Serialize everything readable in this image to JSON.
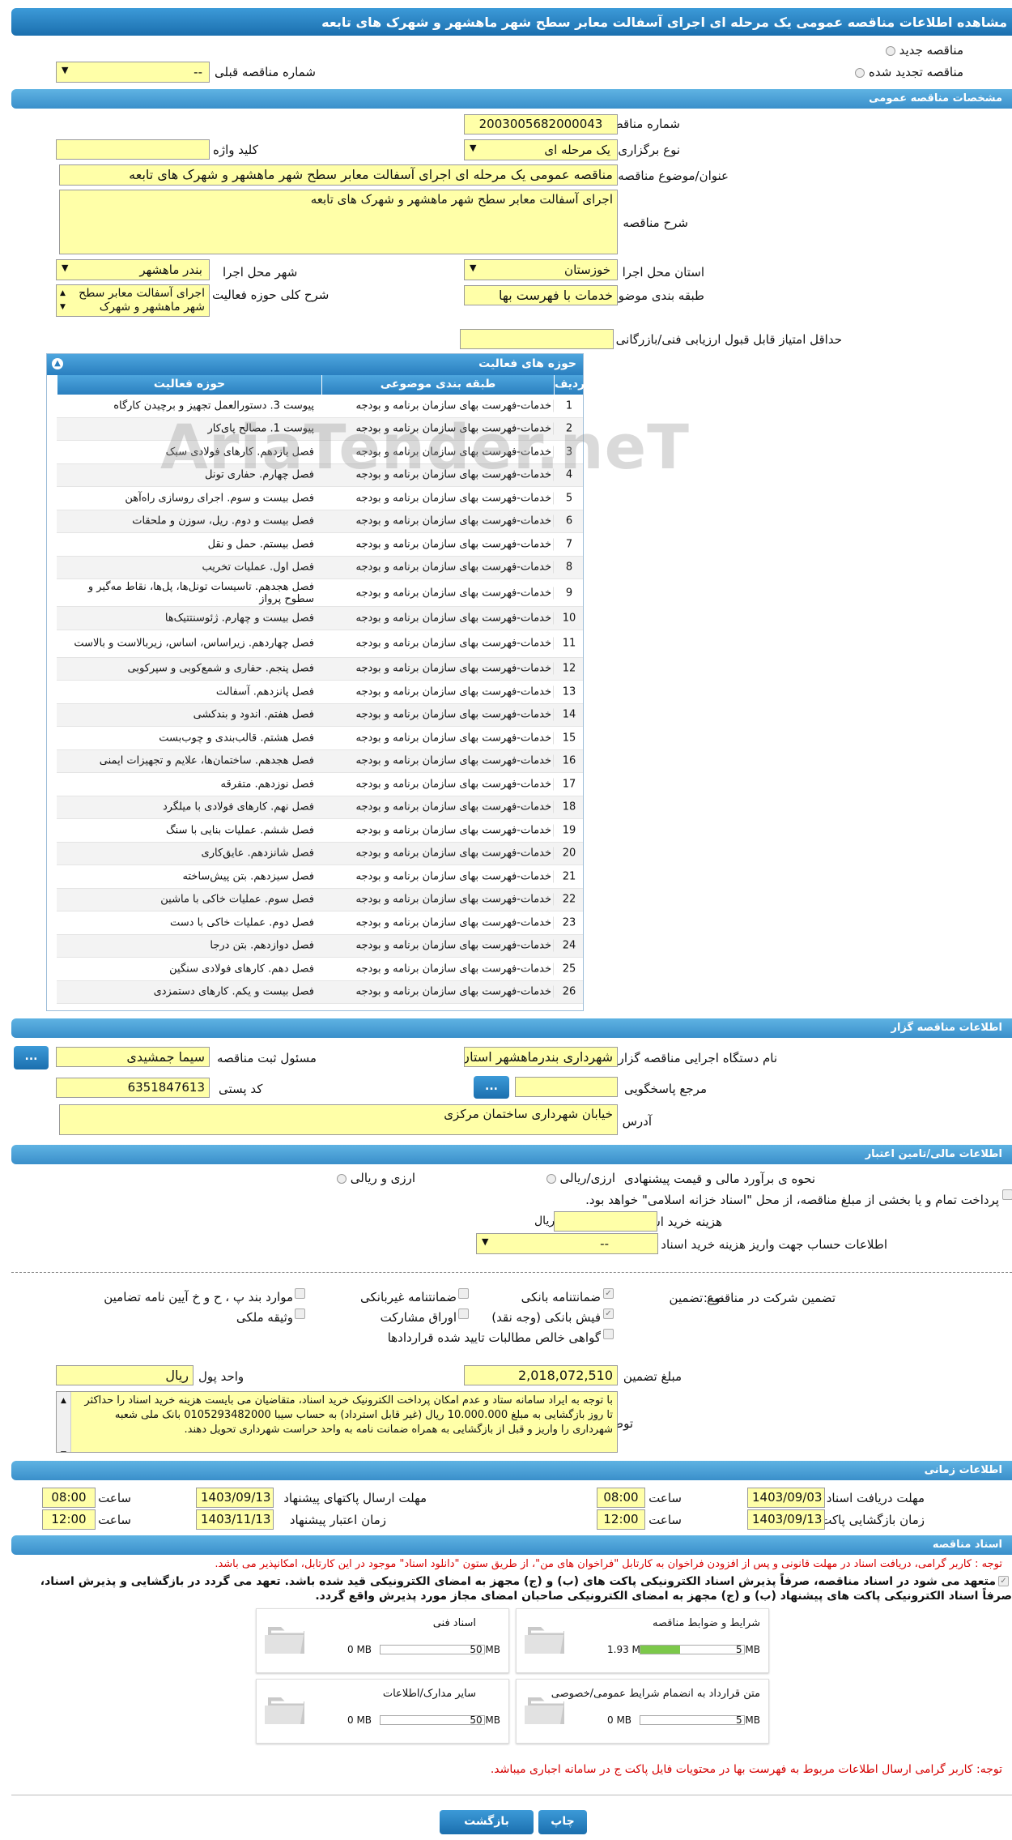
{
  "title": "مشاهده اطلاعات مناقصه عمومی یک مرحله ای اجرای آسفالت معابر سطح شهر ماهشهر و شهرک های تابعه",
  "top": {
    "new_tender": "مناقصه جدید",
    "renewed_tender": "مناقصه تجدید شده",
    "prev_number_label": "شماره مناقصه قبلی",
    "prev_number_value": "--"
  },
  "general": {
    "header": "مشخصات مناقصه عمومی",
    "number_label": "شماره مناقصه",
    "number_value": "2003005682000043",
    "type_label": "نوع برگزاری",
    "type_value": "یک مرحله ای",
    "keyword_label": "کلید واژه",
    "keyword_value": "",
    "subject_label": "عنوان/موضوع مناقصه",
    "subject_value": "مناقصه عمومی یک مرحله ای اجرای آسفالت معابر سطح شهر ماهشهر و شهرک های تابعه",
    "desc_label": "شرح مناقصه",
    "desc_value": "اجرای آسفالت معابر سطح شهر ماهشهر و شهرک های تابعه",
    "province_label": "استان محل اجرا",
    "province_value": "خوزستان",
    "city_label": "شهر محل اجرا",
    "city_value": "بندر ماهشهر",
    "category_label": "طبقه بندی موضوعی",
    "category_value": "خدمات با فهرست بها",
    "scope_label": "شرح کلی حوزه فعالیت",
    "scope_value": "اجرای آسفالت معابر سطح شهر ماهشهر و شهرک",
    "min_score_label": "حداقل امتیاز قابل قبول ارزیابی فنی/بازرگانی",
    "min_score_value": ""
  },
  "activities": {
    "header": "حوزه های فعالیت",
    "col_row": "ردیف",
    "col_category": "طبقه بندی موضوعی",
    "col_scope": "حوزه فعالیت",
    "rows": [
      {
        "n": "1",
        "cat": "خدمات-فهرست بهای سازمان برنامه و بودجه",
        "scope": "پیوست 3. دستورالعمل تجهیز و برچیدن کارگاه"
      },
      {
        "n": "2",
        "cat": "خدمات-فهرست بهای سازمان برنامه و بودجه",
        "scope": "پیوست 1. مصالح پای‌کار"
      },
      {
        "n": "3",
        "cat": "خدمات-فهرست بهای سازمان برنامه و بودجه",
        "scope": "فصل یازدهم. کارهای فولادی سبک"
      },
      {
        "n": "4",
        "cat": "خدمات-فهرست بهای سازمان برنامه و بودجه",
        "scope": "فصل چهارم. حفاری تونل"
      },
      {
        "n": "5",
        "cat": "خدمات-فهرست بهای سازمان برنامه و بودجه",
        "scope": "فصل بیست و سوم. اجرای روسازی راه‌آهن"
      },
      {
        "n": "6",
        "cat": "خدمات-فهرست بهای سازمان برنامه و بودجه",
        "scope": "فصل بیست و دوم. ریل، سوزن و ملحقات"
      },
      {
        "n": "7",
        "cat": "خدمات-فهرست بهای سازمان برنامه و بودجه",
        "scope": "فصل بیستم. حمل و نقل"
      },
      {
        "n": "8",
        "cat": "خدمات-فهرست بهای سازمان برنامه و بودجه",
        "scope": "فصل اول. عملیات تخریب"
      },
      {
        "n": "9",
        "cat": "خدمات-فهرست بهای سازمان برنامه و بودجه",
        "scope": "فصل هجدهم. تاسیسات تونل‌ها، پل‌ها، نقاط مه‌گیر و سطوح پرواز"
      },
      {
        "n": "10",
        "cat": "خدمات-فهرست بهای سازمان برنامه و بودجه",
        "scope": "فصل بیست و چهارم. ژئوسنتتیک‌ها"
      },
      {
        "n": "11",
        "cat": "خدمات-فهرست بهای سازمان برنامه و بودجه",
        "scope": "فصل چهاردهم. زیراساس، اساس، زیربالاست و بالاست"
      },
      {
        "n": "12",
        "cat": "خدمات-فهرست بهای سازمان برنامه و بودجه",
        "scope": "فصل پنجم. حفاری و شمع‌کوبی و سپرکوبی"
      },
      {
        "n": "13",
        "cat": "خدمات-فهرست بهای سازمان برنامه و بودجه",
        "scope": "فصل پانزدهم. آسفالت"
      },
      {
        "n": "14",
        "cat": "خدمات-فهرست بهای سازمان برنامه و بودجه",
        "scope": "فصل هفتم. اندود و بندکشی"
      },
      {
        "n": "15",
        "cat": "خدمات-فهرست بهای سازمان برنامه و بودجه",
        "scope": "فصل هشتم. قالب‌بندی و چوب‌بست"
      },
      {
        "n": "16",
        "cat": "خدمات-فهرست بهای سازمان برنامه و بودجه",
        "scope": "فصل هجدهم. ساختمان‌ها، علایم و تجهیزات ایمنی"
      },
      {
        "n": "17",
        "cat": "خدمات-فهرست بهای سازمان برنامه و بودجه",
        "scope": "فصل نوزدهم. متفرقه"
      },
      {
        "n": "18",
        "cat": "خدمات-فهرست بهای سازمان برنامه و بودجه",
        "scope": "فصل نهم. کارهای فولادی با میلگرد"
      },
      {
        "n": "19",
        "cat": "خدمات-فهرست بهای سازمان برنامه و بودجه",
        "scope": "فصل ششم. عملیات بنایی با سنگ"
      },
      {
        "n": "20",
        "cat": "خدمات-فهرست بهای سازمان برنامه و بودجه",
        "scope": "فصل شانزدهم. عایق‌کاری"
      },
      {
        "n": "21",
        "cat": "خدمات-فهرست بهای سازمان برنامه و بودجه",
        "scope": "فصل سیزدهم. بتن پیش‌ساخته"
      },
      {
        "n": "22",
        "cat": "خدمات-فهرست بهای سازمان برنامه و بودجه",
        "scope": "فصل سوم. عملیات خاکی با ماشین"
      },
      {
        "n": "23",
        "cat": "خدمات-فهرست بهای سازمان برنامه و بودجه",
        "scope": "فصل دوم. عملیات خاکی با دست"
      },
      {
        "n": "24",
        "cat": "خدمات-فهرست بهای سازمان برنامه و بودجه",
        "scope": "فصل دوازدهم. بتن درجا"
      },
      {
        "n": "25",
        "cat": "خدمات-فهرست بهای سازمان برنامه و بودجه",
        "scope": "فصل دهم. کارهای فولادی سنگین"
      },
      {
        "n": "26",
        "cat": "خدمات-فهرست بهای سازمان برنامه و بودجه",
        "scope": "فصل بیست و یکم. کارهای دستمزدی"
      }
    ]
  },
  "organizer": {
    "header": "اطلاعات مناقصه گزار",
    "org_label": "نام دستگاه اجرایی مناقصه گزار",
    "org_value": "شهرداری بندرماهشهر استان",
    "officer_label": "مسئول ثبت مناقصه",
    "officer_value": "سیما جمشیدی",
    "ref_label": "مرجع پاسخگویی",
    "ref_value": "",
    "postal_label": "کد پستی",
    "postal_value": "6351847613",
    "address_label": "آدرس",
    "address_value": "خیابان شهرداری ساختمان مرکزی",
    "dots": "..."
  },
  "financial": {
    "header": "اطلاعات مالی/تامین اعتبار",
    "estimate_label": "نحوه ی برآورد مالی و قیمت پیشنهادی",
    "opt_currency_rial": "ارزی/ریالی",
    "opt_currency_and_rial": "ارزی و ریالی",
    "treasury_text": "پرداخت تمام و یا بخشی از مبلغ مناقصه، از محل \"اسناد خزانه اسلامی\" خواهد بود.",
    "doc_cost_label": "هزینه خرید اسناد",
    "doc_cost_value": "",
    "doc_cost_unit": "ریال",
    "account_label": "اطلاعات حساب جهت واریز هزینه خرید اسناد",
    "account_value": "--",
    "guarantee_label": "تضمین شرکت در مناقصه:",
    "guarantee_type_label": "نوع تضمین",
    "g_bank": "ضمانتنامه بانکی",
    "g_nonbank": "ضمانتنامه غیربانکی",
    "g_clauses": "موارد بند پ ، ح و خ آیین نامه تضامین",
    "g_check": "فیش بانکی (وجه نقد)",
    "g_bonds": "اوراق مشارکت",
    "g_property": "وثیقه ملکی",
    "g_claims": "گواهی خالص مطالبات تایید شده قراردادها",
    "amount_label": "مبلغ تضمین",
    "amount_value": "2,018,072,510",
    "currency_label": "واحد پول",
    "currency_value": "ریال",
    "notes_label": "توضیحات",
    "notes_value": "با توجه به ایراد سامانه ستاد و عدم امکان پرداخت الکترونیک خرید اسناد، متقاضیان می بایست هزینه خرید اسناد را حداکثر تا روز بازگشایی به مبلغ 10.000.000 ریال (غیر قابل استرداد) به حساب سیبا 0105293482000 بانک ملی شعبه شهرداری را واریز و قبل از بازگشایی به همراه ضمانت نامه به واحد حراست شهرداری تحویل دهند."
  },
  "timing": {
    "header": "اطلاعات زمانی",
    "receive_label": "مهلت دریافت اسناد",
    "receive_date": "1403/09/03",
    "receive_time": "08:00",
    "send_label": "مهلت ارسال پاکتهای پیشنهاد",
    "send_date": "1403/09/13",
    "send_time": "08:00",
    "open_label": "زمان بازگشایی پاکت ها",
    "open_date": "1403/09/13",
    "open_time": "12:00",
    "valid_label": "زمان اعتبار پیشنهاد",
    "valid_date": "1403/11/13",
    "valid_time": "12:00",
    "time_label": "ساعت"
  },
  "documents": {
    "header": "اسناد مناقصه",
    "note1": "توجه : کاربر گرامی، دریافت اسناد در مهلت قانونی و پس از افزودن فراخوان به کارتابل \"فراخوان های من\"، از طریق ستون \"دانلود اسناد\" موجود در این کارتابل، امکانپذیر می باشد.",
    "commit1": "متعهد می شود در اسناد مناقصه، صرفاً پذیرش اسناد الکترونیکی پاکت های (ب) و (ج) مجهز به امضای الکترونیکی قید شده باشد. تعهد می گردد در بازگشایی و پذیرش اسناد،",
    "commit2": "صرفاً اسناد الکترونیکی پاکت های پیشنهاد (ب) و (ج) مجهز به امضای الکترونیکی صاحبان امضای مجاز مورد پذیرش واقع گردد.",
    "files": [
      {
        "name": "شرایط و ضوابط مناقصه",
        "current": "1.93 MB",
        "max": "5 MB",
        "fill": 0.386
      },
      {
        "name": "اسناد فنی",
        "current": "0 MB",
        "max": "50 MB",
        "fill": 0
      },
      {
        "name": "متن قرارداد به انضمام شرایط عمومی/خصوصی",
        "current": "0 MB",
        "max": "5 MB",
        "fill": 0
      },
      {
        "name": "سایر مدارک/اطلاعات",
        "current": "0 MB",
        "max": "50 MB",
        "fill": 0
      }
    ],
    "note2": "توجه: کاربر گرامی ارسال اطلاعات مربوط به فهرست بها در محتویات فایل پاکت ج در سامانه اجباری میباشد."
  },
  "footer": {
    "back": "بازگشت",
    "print": "چاپ"
  },
  "watermark": "AriaTender.neT"
}
